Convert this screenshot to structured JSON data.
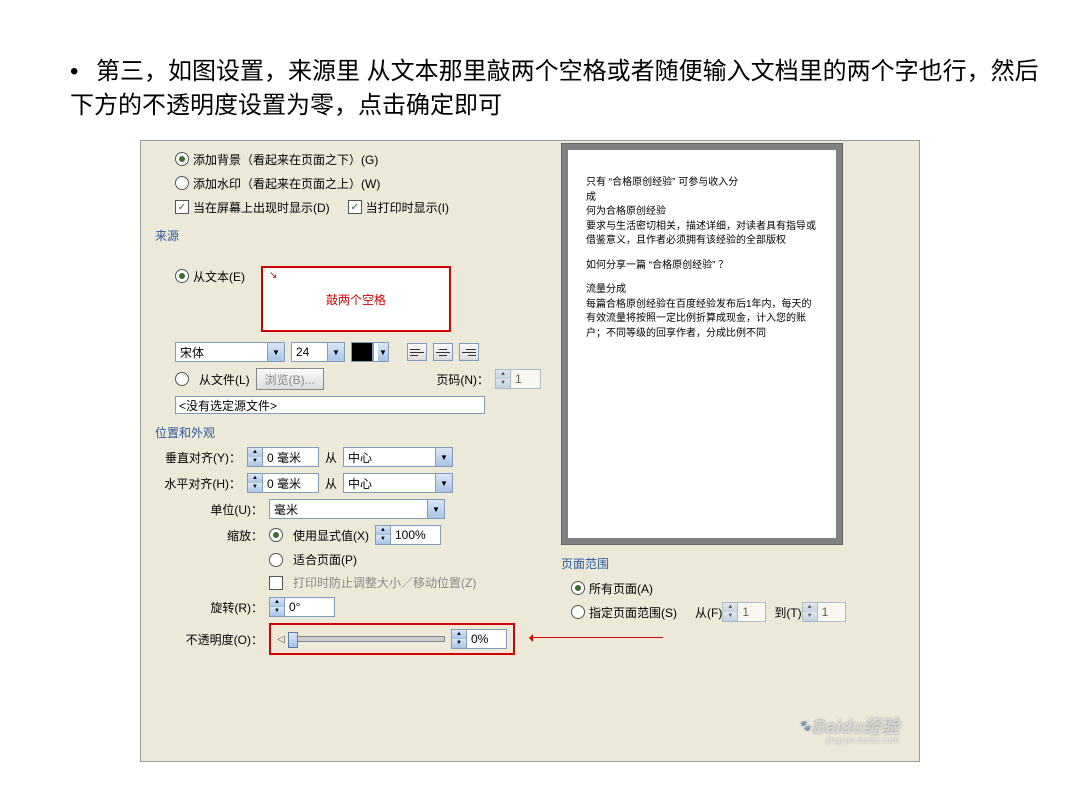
{
  "bullet": "第三，如图设置，来源里 从文本那里敲两个空格或者随便输入文档里的两个字也行，然后下方的不透明度设置为零，点击确定即可",
  "type_section": {
    "add_bg": "添加背景（看起来在页面之下）(G)",
    "add_wm": "添加水印（看起来在页面之上）(W)",
    "show_screen": "当在屏幕上出现时显示(D)",
    "show_print": "当打印时显示(I)"
  },
  "source": {
    "title": "来源",
    "from_text": "从文本(E)",
    "hint": "敲两个空格",
    "font_name": "宋体",
    "font_size": "24",
    "from_file": "从文件(L)",
    "browse": "浏览(B)...",
    "page_no": "页码(N)：",
    "page_val": "1",
    "no_src": "<没有选定源文件>"
  },
  "appearance": {
    "title": "位置和外观",
    "valign": "垂直对齐(Y)：",
    "valign_val": "0 毫米",
    "from": "从",
    "center": "中心",
    "halign": "水平对齐(H)：",
    "halign_val": "0 毫米",
    "unit": "单位(U)：",
    "unit_val": "毫米",
    "scale": "缩放：",
    "use_explicit": "使用显式值(X)",
    "scale_val": "100%",
    "fit_page": "适合页面(P)",
    "lock": "打印时防止调整大小／移动位置(Z)",
    "rotate": "旋转(R)：",
    "rotate_val": "0°",
    "opacity": "不透明度(O)：",
    "opacity_val": "0%"
  },
  "preview": {
    "p1a": "只有 “合格原创经验” 可参与收入分",
    "p1b": "成",
    "p2": "何为合格原创经验",
    "p3": "要求与生活密切相关，描述详细，对读者具有指导或借鉴意义，且作者必须拥有该经验的全部版权",
    "p4": "如何分享一篇 “合格原创经验” ？",
    "p5": "流量分成",
    "p6": "每篇合格原创经验在百度经验发布后1年内，每天的有效流量将按照一定比例折算成现金，计入您的账户；不同等级的回享作者，分成比例不同"
  },
  "range": {
    "title": "页面范围",
    "all": "所有页面(A)",
    "spec": "指定页面范围(S)",
    "from": "从(F)",
    "to": "到(T)",
    "from_val": "1",
    "to_val": "1"
  },
  "baidu": "Baidu经验"
}
